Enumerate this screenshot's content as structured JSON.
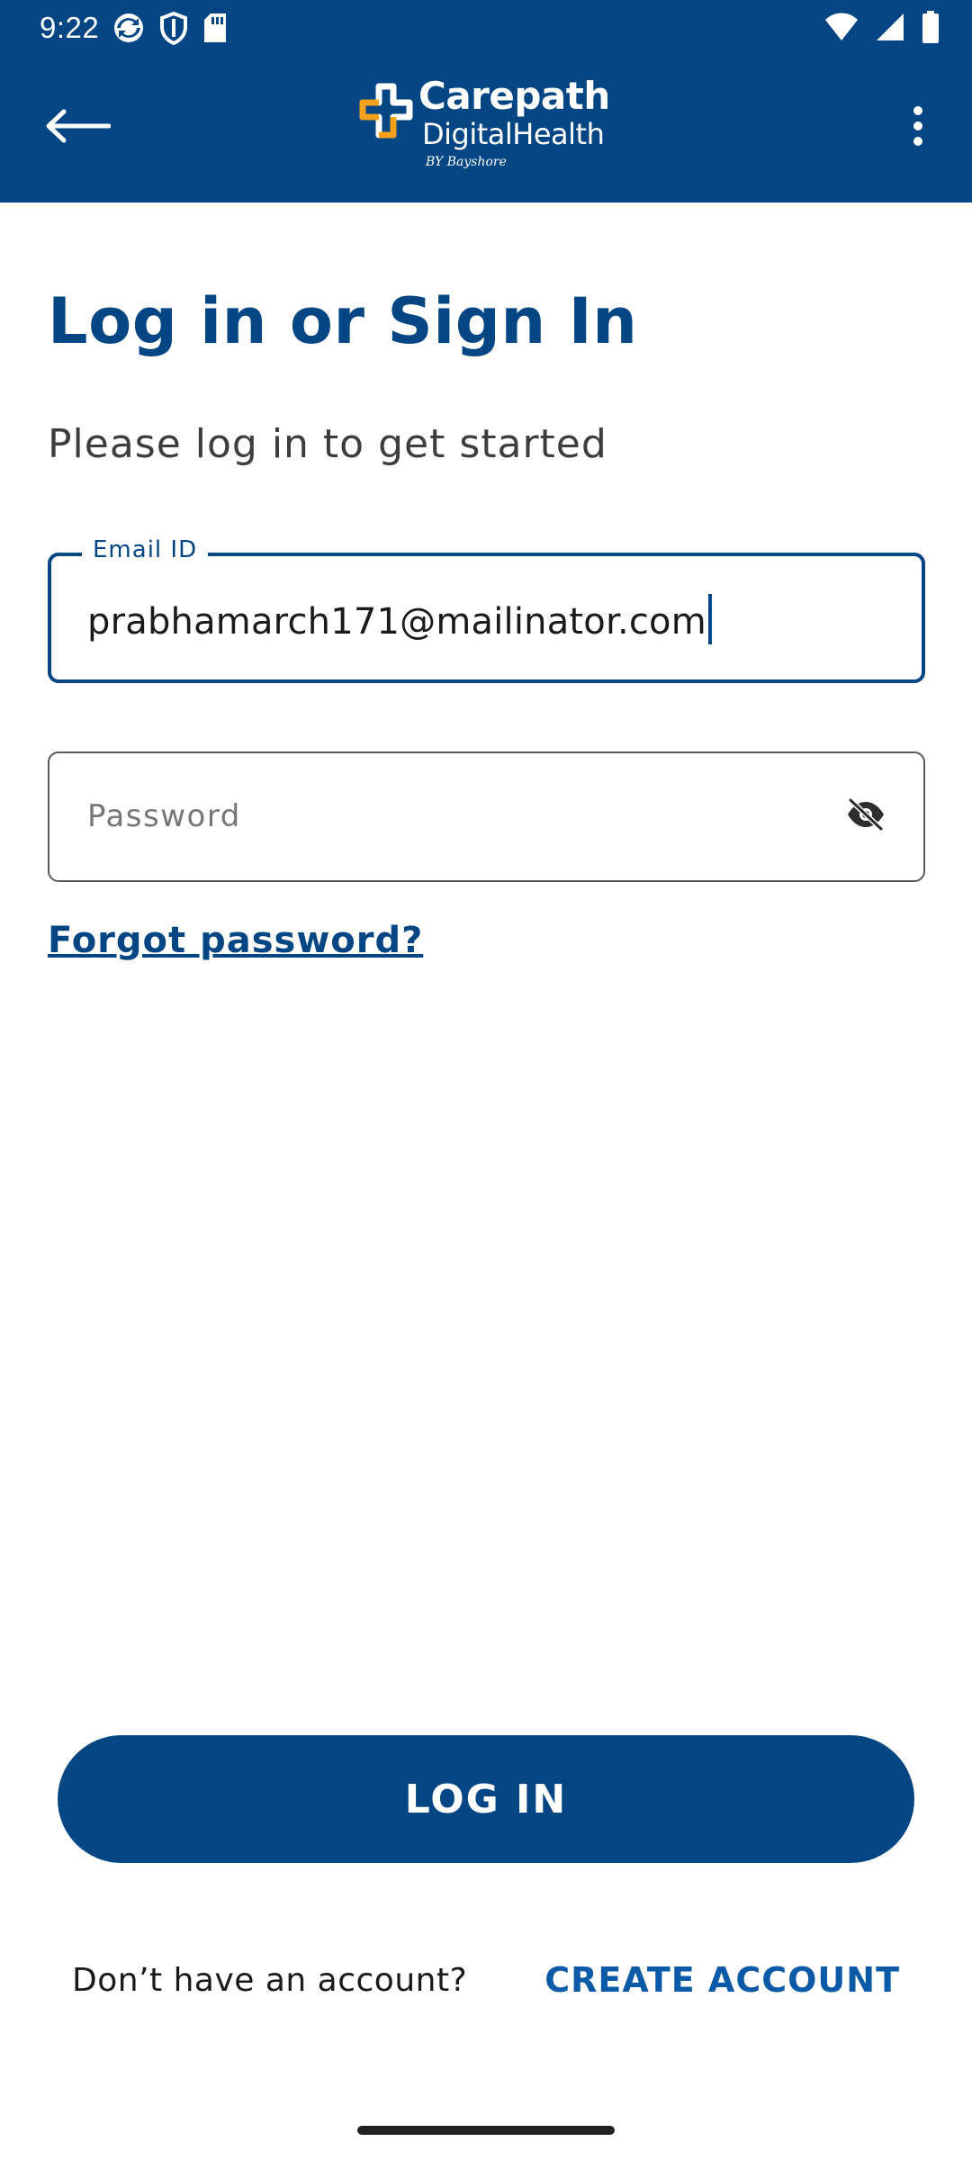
{
  "status_bar": {
    "time": "9:22",
    "left_icons": [
      "sync-icon",
      "shield-icon",
      "sd-card-icon"
    ],
    "right_icons": [
      "wifi-icon",
      "signal-icon",
      "battery-icon"
    ]
  },
  "app_bar": {
    "back_icon": "arrow-left-icon",
    "menu_icon": "more-vertical-icon",
    "logo": {
      "line1": "Carepath",
      "line2": "DigitalHealth",
      "byline": "BY Bayshore"
    }
  },
  "main": {
    "title": "Log in or Sign In",
    "subtitle": "Please log in to get started",
    "email": {
      "label": "Email ID",
      "value": "prabhamarch171@mailinator.com"
    },
    "password": {
      "placeholder": "Password",
      "toggle_icon": "visibility-off-icon"
    },
    "forgot_password": "Forgot password?",
    "login_button": "LOG IN",
    "no_account_text": "Don’t have an account?",
    "create_account": "CREATE ACCOUNT"
  },
  "colors": {
    "brand_navy": "#044584",
    "accent_orange": "#f5a11c",
    "link_blue": "#0a5aa8"
  }
}
